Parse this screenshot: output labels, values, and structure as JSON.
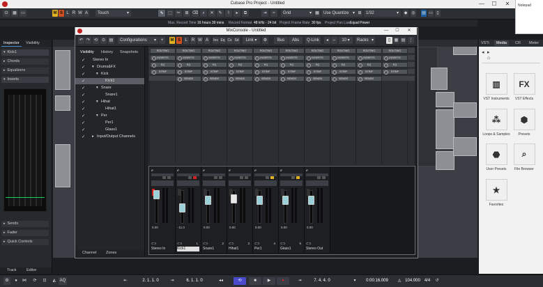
{
  "window": {
    "title": "Cubase Pro Project - Untitled",
    "minimize": "—",
    "maximize": "☐",
    "close": "✕"
  },
  "notepad": {
    "title": "Notepad"
  },
  "toolbar": {
    "m_label": "M",
    "s_label": "S",
    "l_label": "L",
    "r_label": "R",
    "w_label": "W",
    "a_label": "A",
    "automation_mode": "Touch",
    "grid_label": "Grid",
    "quantize_label": "Use Quantize",
    "quantize_value": "1/32"
  },
  "infobar": {
    "max_record_time_label": "Max. Record Time",
    "max_record_time_value": "16 hours 39 mins",
    "record_format_label": "Record Format",
    "record_format_value": "48 kHz - 24 bit",
    "frame_rate_label": "Project Frame Rate",
    "frame_rate_value": "30 fps",
    "pan_law_label": "Project Pan Law",
    "pan_law_value": "Equal Power"
  },
  "inspector": {
    "tab_inspector": "Inspector",
    "tab_visibility": "Visibility",
    "track_name": "Kick1",
    "sections": [
      "Chords",
      "Equalizers",
      "Inserts"
    ],
    "bottom_sections": [
      "Sends",
      "Fader",
      "Quick Controls"
    ]
  },
  "bottom_left_tabs": {
    "track": "Track",
    "editor": "Editor"
  },
  "mixconsole": {
    "title": "MixConsole - Untitled",
    "configurations_label": "Configurations",
    "link_label": "Link",
    "bus_label": "Bus",
    "abs_label": "Abs",
    "qlink_label": "Q-Link",
    "count": "10",
    "racks_label": "Racks",
    "visibility_tabs": [
      "Visibility",
      "History",
      "Snapshots"
    ],
    "visibility_items": [
      {
        "name": "Stereo In",
        "checked": true,
        "selected": false,
        "indent": 0,
        "expand": ""
      },
      {
        "name": "Drums&FX",
        "checked": true,
        "selected": false,
        "indent": 1,
        "expand": "▾"
      },
      {
        "name": "Kick",
        "checked": true,
        "selected": false,
        "indent": 2,
        "expand": "▾"
      },
      {
        "name": "Kick1",
        "checked": true,
        "selected": true,
        "indent": 3,
        "expand": ""
      },
      {
        "name": "Snare",
        "checked": true,
        "selected": false,
        "indent": 2,
        "expand": "▾"
      },
      {
        "name": "Snare1",
        "checked": true,
        "selected": false,
        "indent": 3,
        "expand": ""
      },
      {
        "name": "Hihat",
        "checked": true,
        "selected": false,
        "indent": 2,
        "expand": "▾"
      },
      {
        "name": "Hihat1",
        "checked": true,
        "selected": false,
        "indent": 3,
        "expand": ""
      },
      {
        "name": "Per",
        "checked": true,
        "selected": false,
        "indent": 2,
        "expand": "▾"
      },
      {
        "name": "Per1",
        "checked": true,
        "selected": false,
        "indent": 3,
        "expand": ""
      },
      {
        "name": "Glass1",
        "checked": true,
        "selected": false,
        "indent": 3,
        "expand": ""
      },
      {
        "name": "Input/Output Channels",
        "checked": true,
        "selected": false,
        "indent": 1,
        "expand": "▸"
      }
    ],
    "rack_labels": [
      "ROUTING",
      "INSERTS",
      "EQ",
      "STRIP",
      "SENDS"
    ],
    "bottom_tabs": {
      "channel": "Channel",
      "zones": "Zones"
    },
    "channels": [
      {
        "name": "Stereo In",
        "number": "",
        "value": "0.00",
        "selected": false,
        "muted": false,
        "soloed": false
      },
      {
        "name": "Kick1",
        "number": "1",
        "value": "-11.0",
        "selected": true,
        "muted": false,
        "soloed": false
      },
      {
        "name": "Snare1",
        "number": "2",
        "value": "0.00",
        "selected": false,
        "muted": false,
        "soloed": false
      },
      {
        "name": "Hihat1",
        "number": "3",
        "value": "0.00",
        "selected": false,
        "muted": false,
        "soloed": false
      },
      {
        "name": "Per1",
        "number": "4",
        "value": "0.00",
        "selected": false,
        "muted": false,
        "soloed": true
      },
      {
        "name": "Glass1",
        "number": "5",
        "value": "0.00",
        "selected": false,
        "muted": false,
        "soloed": true
      },
      {
        "name": "Stereo Out",
        "number": "",
        "value": "0.00",
        "selected": false,
        "muted": false,
        "soloed": false
      }
    ]
  },
  "right_panel": {
    "tabs": [
      "VSTi",
      "Media",
      "CR",
      "Meter"
    ],
    "items": [
      {
        "label": "VST Instruments",
        "icon": "piano-icon"
      },
      {
        "label": "VST Effects",
        "icon": "fx-icon"
      },
      {
        "label": "Loops & Samples",
        "icon": "loops-icon"
      },
      {
        "label": "Presets",
        "icon": "presets-icon"
      },
      {
        "label": "User Presets",
        "icon": "user-presets-icon"
      },
      {
        "label": "File Browser",
        "icon": "file-browser-icon"
      },
      {
        "label": "Favorites",
        "icon": "star-icon"
      }
    ]
  },
  "transport": {
    "aq_label": "AQ",
    "left_locator": "2. 1. 1. 0",
    "right_locator": "6. 1. 1. 0",
    "position": "7. 4. 4. 0",
    "time": "0:00:16.009",
    "tempo": "104.000",
    "signature": "4/4"
  },
  "colors": {
    "mute": "#e0b020",
    "solo": "#d05020",
    "accent": "#4a90d0",
    "meter_red": "#d02020"
  }
}
